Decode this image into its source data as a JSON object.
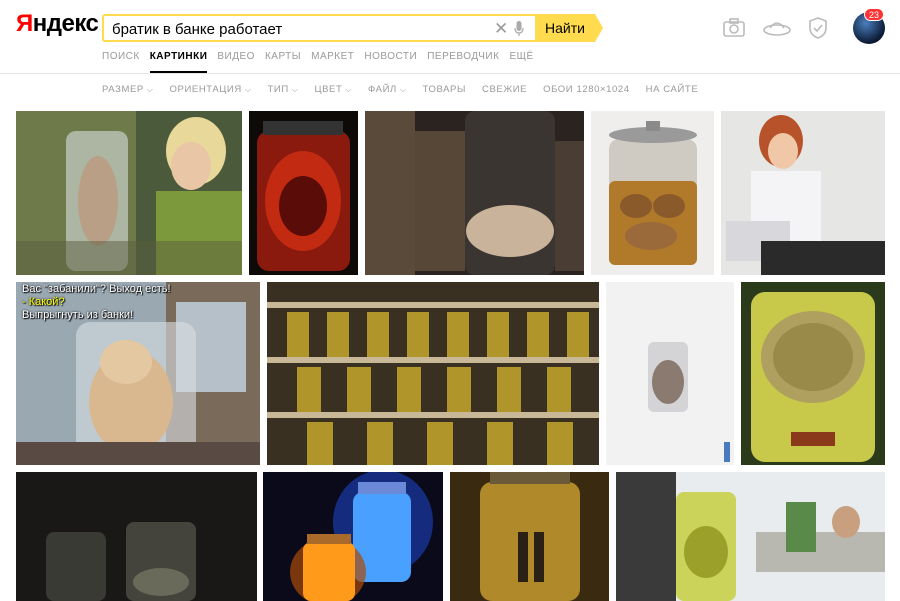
{
  "logo": {
    "first": "Я",
    "rest": "ндекс"
  },
  "search": {
    "query": "братик в банке работает",
    "button": "Найти"
  },
  "tabs": [
    "ПОИСК",
    "КАРТИНКИ",
    "ВИДЕО",
    "КАРТЫ",
    "МАРКЕТ",
    "НОВОСТИ",
    "ПЕРЕВОДЧИК",
    "ЕЩЁ"
  ],
  "active_tab": "КАРТИНКИ",
  "header_icons": [
    "camera-icon",
    "ufo-icon",
    "shield-icon"
  ],
  "notifications": "23",
  "filters": [
    {
      "label": "РАЗМЕР",
      "dropdown": true
    },
    {
      "label": "ОРИЕНТАЦИЯ",
      "dropdown": true
    },
    {
      "label": "ТИП",
      "dropdown": true
    },
    {
      "label": "ЦВЕТ",
      "dropdown": true
    },
    {
      "label": "ФАЙЛ",
      "dropdown": true
    },
    {
      "label": "ТОВАРЫ",
      "dropdown": false
    },
    {
      "label": "СВЕЖИЕ",
      "dropdown": false
    },
    {
      "label": "ОБОИ 1280×1024",
      "dropdown": false
    },
    {
      "label": "НА САЙТЕ",
      "dropdown": false
    }
  ],
  "overlay": {
    "line1": "Вас \"забанили\"? Выход есть!",
    "line2": "- Какой?",
    "line3": "Выпрыгнуть из банки!"
  },
  "colors": {
    "search_accent": "#ffdb4d",
    "logo_red": "#ff0000",
    "badge": "#ff3333"
  }
}
